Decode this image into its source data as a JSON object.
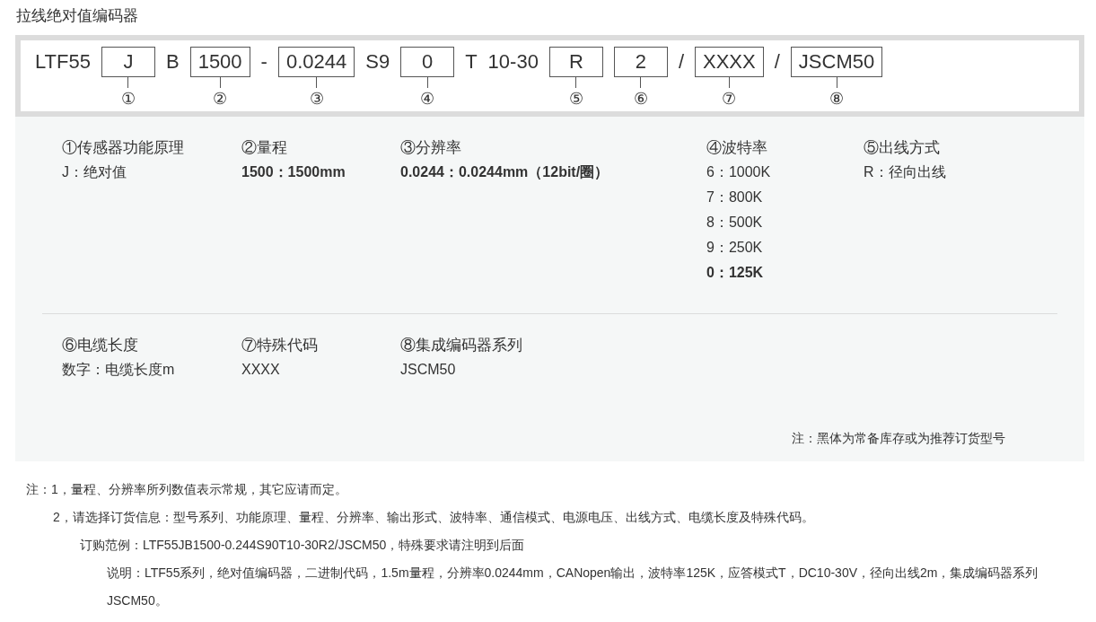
{
  "title": "拉线绝对值编码器",
  "code_segments": [
    {
      "kind": "text",
      "text": "LTF55"
    },
    {
      "kind": "box",
      "text": "J",
      "marker": "①"
    },
    {
      "kind": "text",
      "text": "B"
    },
    {
      "kind": "box",
      "text": "1500",
      "marker": "②"
    },
    {
      "kind": "text",
      "text": "-"
    },
    {
      "kind": "box",
      "text": "0.0244",
      "marker": "③"
    },
    {
      "kind": "text",
      "text": "S9"
    },
    {
      "kind": "box",
      "text": "0",
      "marker": "④"
    },
    {
      "kind": "text",
      "text": "T"
    },
    {
      "kind": "text",
      "text": "10-30"
    },
    {
      "kind": "box",
      "text": "R",
      "marker": "⑤"
    },
    {
      "kind": "box",
      "text": "2",
      "marker": "⑥"
    },
    {
      "kind": "text",
      "text": "/"
    },
    {
      "kind": "box",
      "text": "XXXX",
      "marker": "⑦"
    },
    {
      "kind": "text",
      "text": "/"
    },
    {
      "kind": "box",
      "text": "JSCM50",
      "marker": "⑧"
    }
  ],
  "legend_rows": [
    [
      {
        "title": "①传感器功能原理",
        "lines": [
          {
            "text": "J：绝对值",
            "bold": false
          }
        ]
      },
      {
        "title": "②量程",
        "lines": [
          {
            "text": "1500：1500mm",
            "bold": true
          }
        ]
      },
      {
        "title": "③分辨率",
        "lines": [
          {
            "text": "0.0244：0.0244mm（12bit/圈）",
            "bold": true
          }
        ]
      },
      {
        "title": "④波特率",
        "lines": [
          {
            "text": "6：1000K",
            "bold": false
          },
          {
            "text": "7：800K",
            "bold": false
          },
          {
            "text": "8：500K",
            "bold": false
          },
          {
            "text": "9：250K",
            "bold": false
          },
          {
            "text": "0：125K",
            "bold": true
          }
        ]
      },
      {
        "title": "⑤出线方式",
        "lines": [
          {
            "text": "R：径向出线",
            "bold": false
          }
        ]
      }
    ],
    [
      {
        "title": "⑥电缆长度",
        "lines": [
          {
            "text": "数字：电缆长度m",
            "bold": false
          }
        ]
      },
      {
        "title": "⑦特殊代码",
        "lines": [
          {
            "text": "XXXX",
            "bold": false
          }
        ]
      },
      {
        "title": "⑧集成编码器系列",
        "lines": [
          {
            "text": "JSCM50",
            "bold": false
          }
        ]
      }
    ]
  ],
  "panel_note": "注：黑体为常备库存或为推荐订货型号",
  "notes": [
    {
      "text": "注：1，量程、分辨率所列数值表示常规，其它应请而定。",
      "children": [
        {
          "text": "2，请选择订货信息：型号系列、功能原理、量程、分辨率、输出形式、波特率、通信模式、电源电压、出线方式、电缆长度及特殊代码。",
          "children": [
            {
              "text": "订购范例：LTF55JB1500-0.244S90T10-30R2/JSCM50，特殊要求请注明到后面",
              "children": [
                {
                  "text": "说明：LTF55系列，绝对值编码器，二进制代码，1.5m量程，分辨率0.0244mm，CANopen输出，波特率125K，应答模式T，DC10-30V，径向出线2m，集成编码器系列JSCM50。"
                }
              ]
            }
          ]
        }
      ]
    }
  ]
}
